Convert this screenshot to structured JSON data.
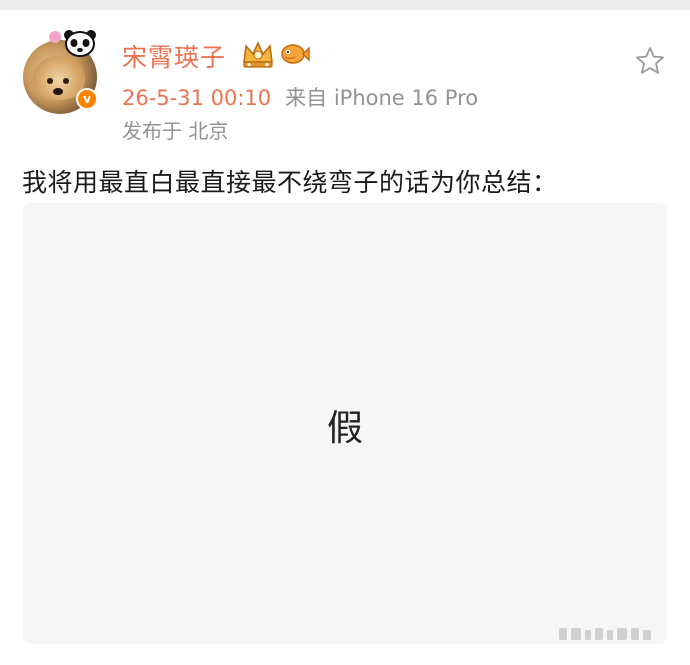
{
  "post": {
    "username": "宋霄瑛子",
    "time": "26-5-31 00:10",
    "source": "来自 iPhone 16 Pro",
    "location": "发布于 北京",
    "text": "我将用最直白最直接最不绕弯子的话为你总结：",
    "image_text": "假"
  },
  "icons": {
    "avatar": "avatar-dog-photo",
    "verified": "verified-v-badge",
    "verified_letter": "v",
    "crown": "crown-badge-icon",
    "fish": "fish-badge-icon",
    "favorite": "star-icon"
  },
  "colors": {
    "username": "#eb7350",
    "meta": "#939393",
    "verified": "#ff8200"
  }
}
